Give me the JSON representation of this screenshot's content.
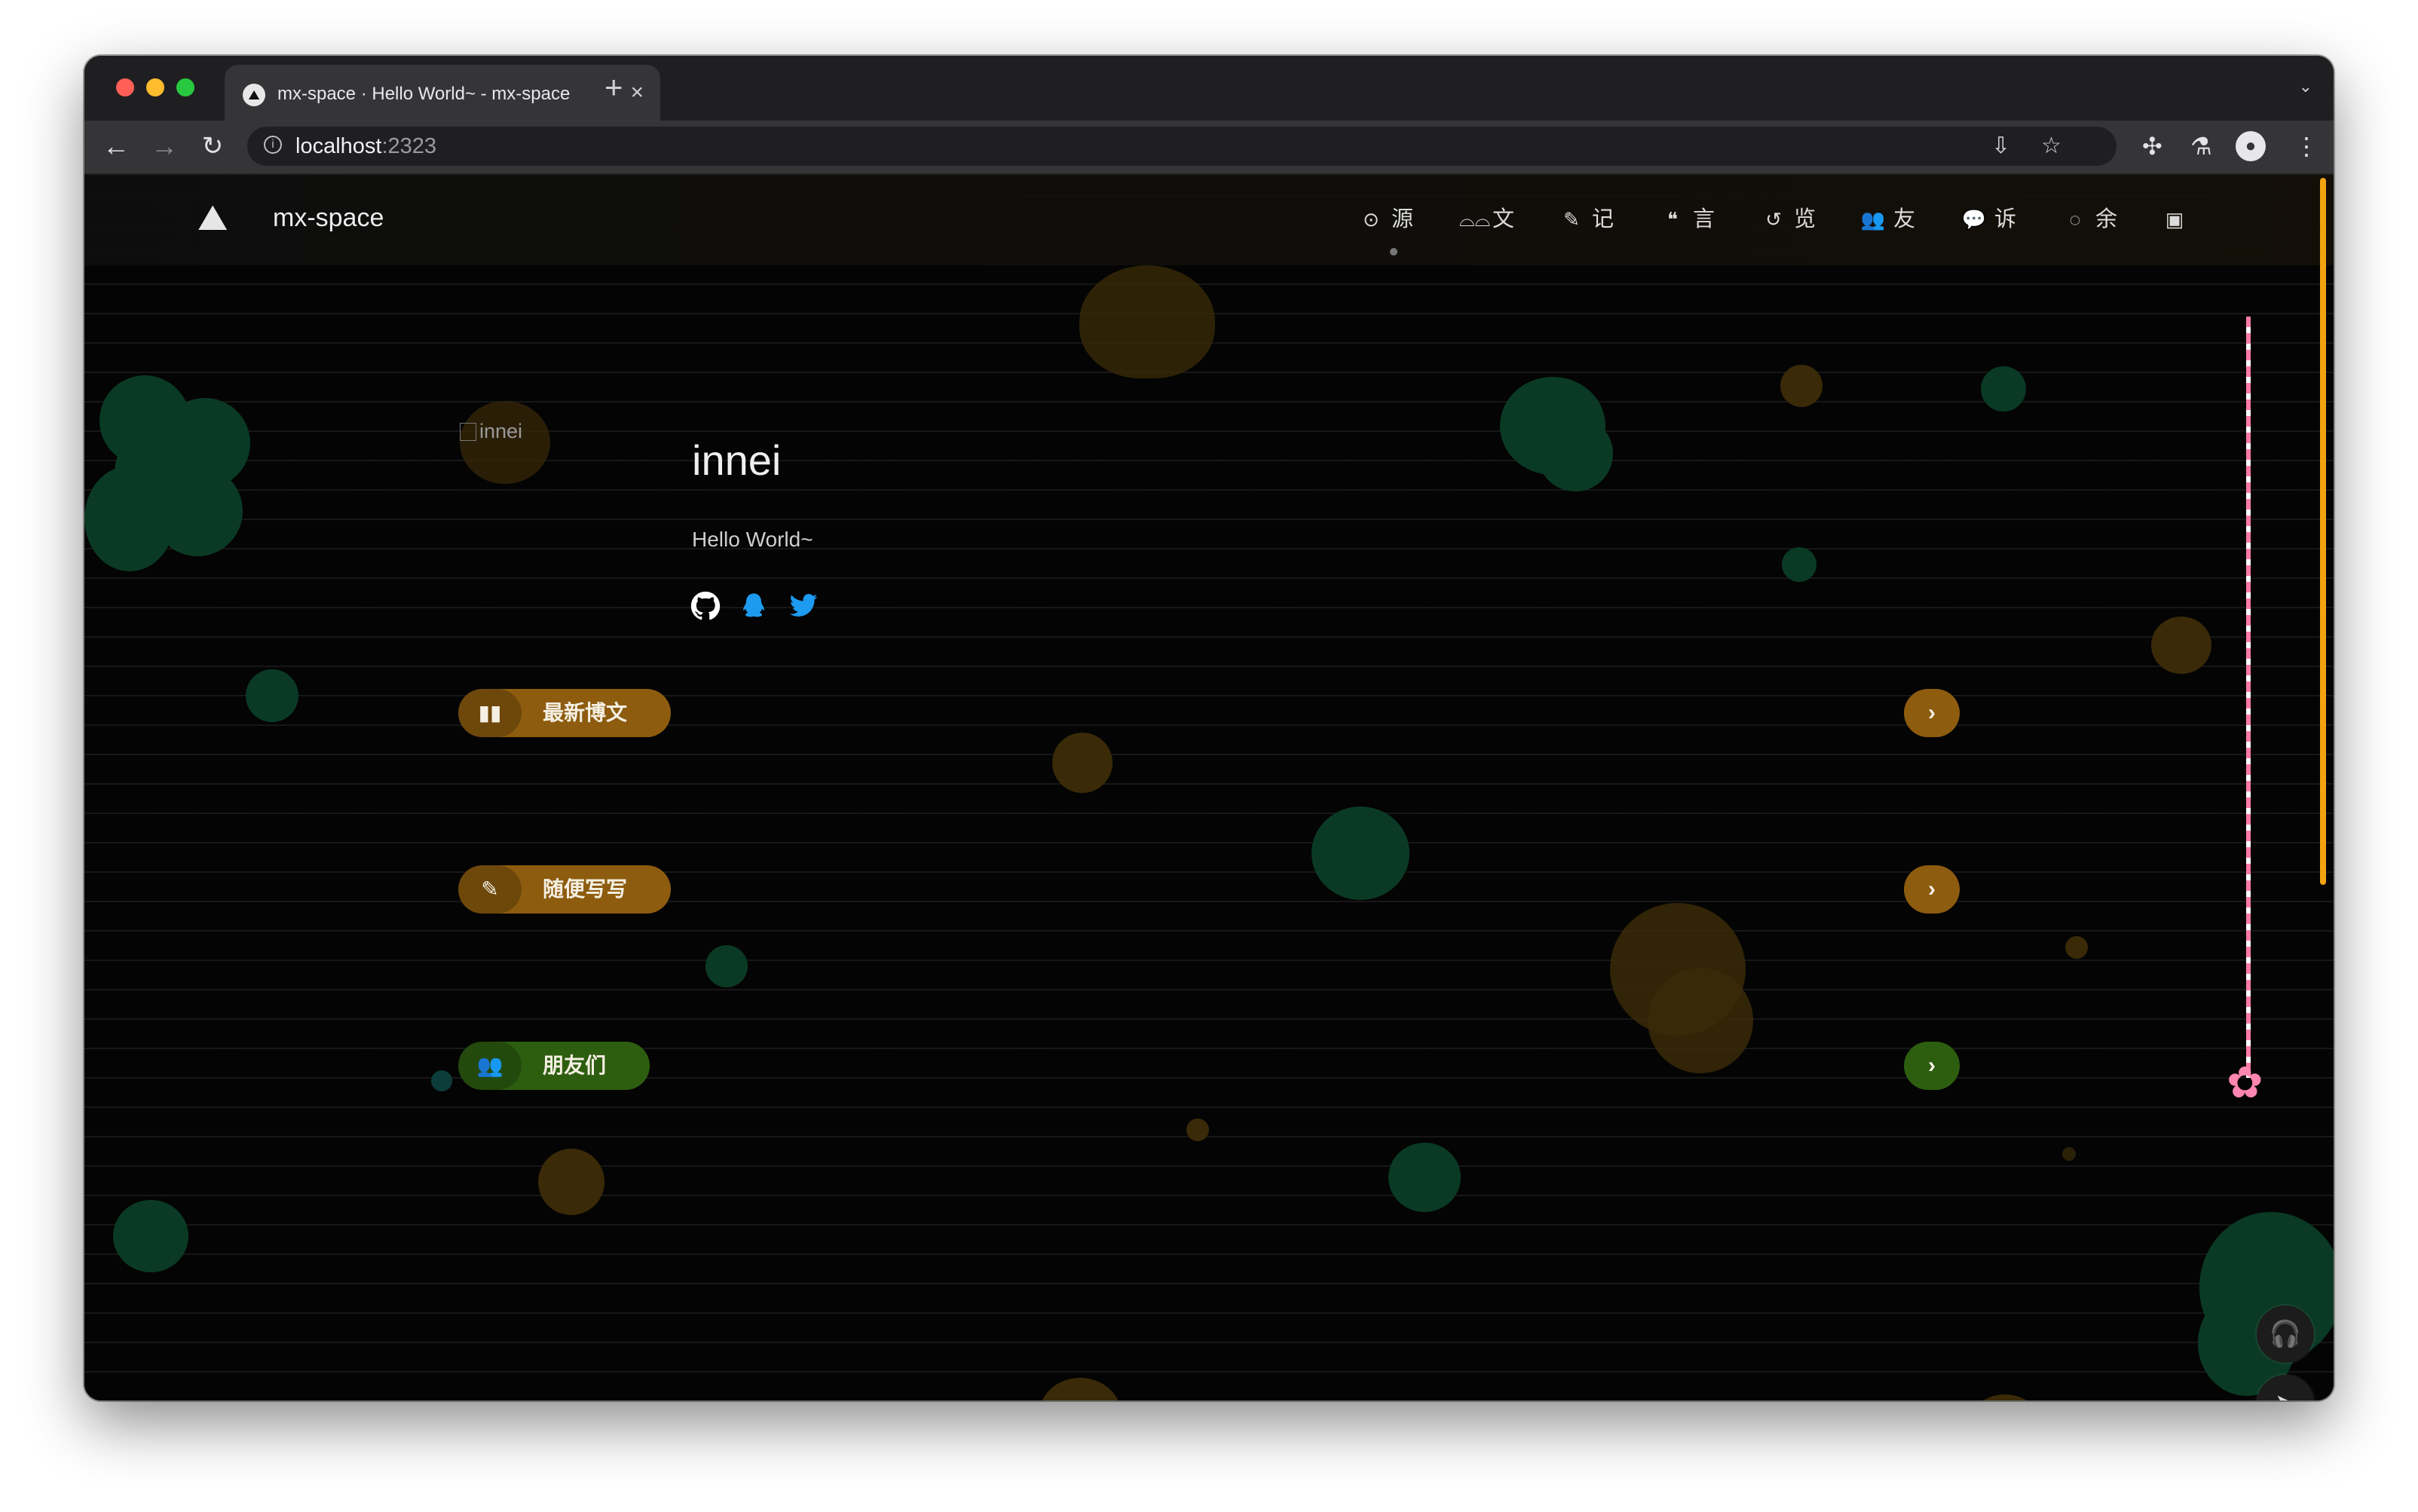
{
  "browser": {
    "tab_title": "mx-space · Hello World~ - mx-space",
    "tab_close": "×",
    "new_tab": "+",
    "tab_menu": "⌄",
    "url_host": "localhost",
    "url_port": ":2323"
  },
  "site": {
    "name": "mx-space",
    "logo_icon": "trees-icon",
    "nav": [
      {
        "icon": "⊙",
        "label": "源"
      },
      {
        "icon": "⌓⌓",
        "label": "文"
      },
      {
        "icon": "✎",
        "label": "记"
      },
      {
        "icon": "❝",
        "label": "言"
      },
      {
        "icon": "↺",
        "label": "览"
      },
      {
        "icon": "👥",
        "label": "友"
      },
      {
        "icon": "💬",
        "label": "诉"
      },
      {
        "icon": "◌",
        "label": "余"
      },
      {
        "icon": "▣",
        "label": ""
      }
    ]
  },
  "profile": {
    "avatar_alt": "innei",
    "name": "innei",
    "description": "Hello World~",
    "social": [
      "github-icon",
      "qq-icon",
      "twitter-icon"
    ]
  },
  "sections": [
    {
      "label": "最新博文",
      "icon": "book-icon",
      "color": "#8d5c0f"
    },
    {
      "label": "随便写写",
      "icon": "pencil-icon",
      "color": "#8d5c0f"
    },
    {
      "label": "朋友们",
      "icon": "users-icon",
      "color": "#2d5e10"
    }
  ],
  "colors": {
    "accent_orange": "#f2a30f",
    "pill_brown": "#8d5c0f",
    "pill_green": "#2d5e10",
    "sakura_pink": "#ff86b0"
  }
}
